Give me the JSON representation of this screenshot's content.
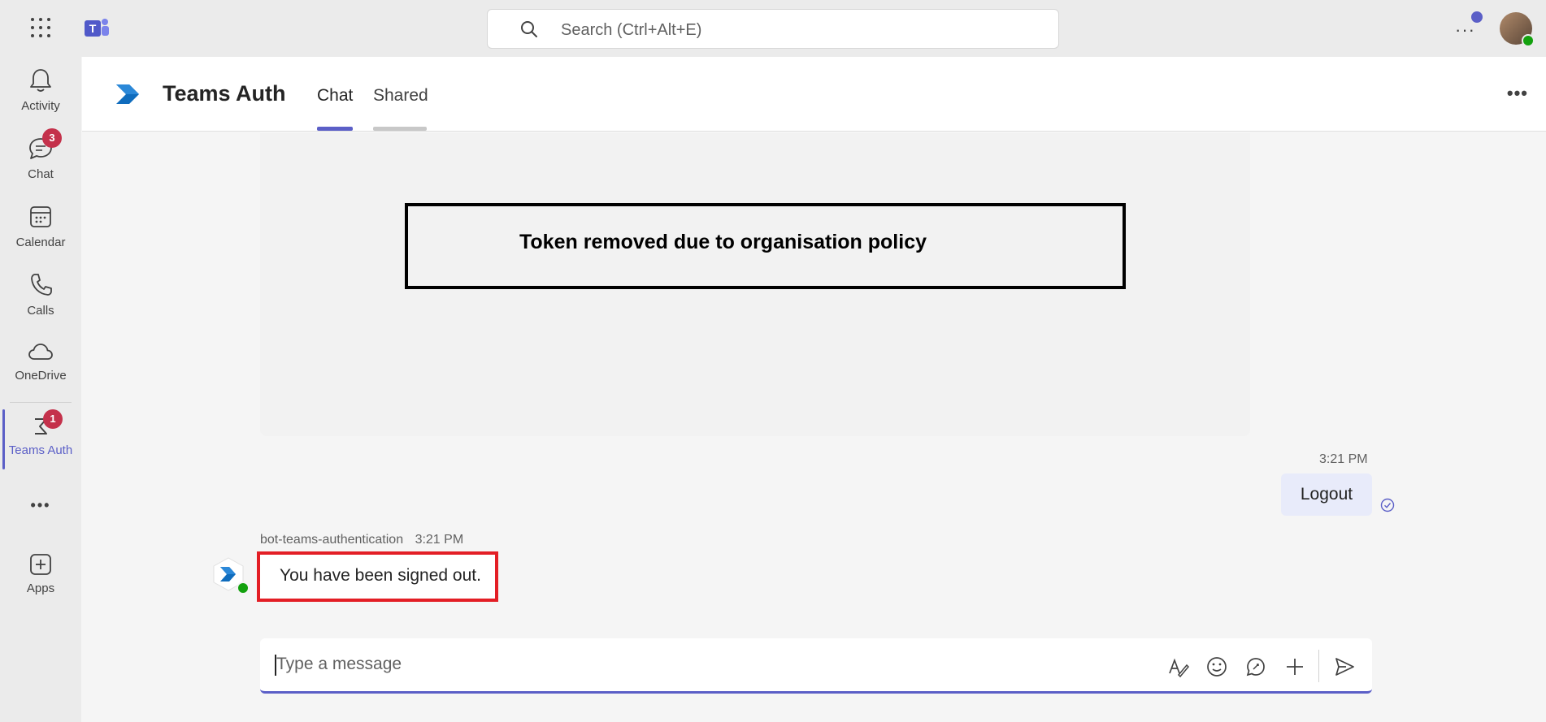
{
  "topbar": {
    "search_placeholder": "Search (Ctrl+Alt+E)",
    "more_label": "···"
  },
  "rail": {
    "items": [
      {
        "label": "Activity",
        "icon": "bell-icon"
      },
      {
        "label": "Chat",
        "icon": "chat-icon",
        "badge": "3"
      },
      {
        "label": "Calendar",
        "icon": "calendar-icon"
      },
      {
        "label": "Calls",
        "icon": "phone-icon"
      },
      {
        "label": "OneDrive",
        "icon": "cloud-icon"
      },
      {
        "label": "Teams Auth",
        "icon": "app-icon",
        "badge": "1",
        "active": true
      },
      {
        "label": "•••",
        "icon": "more-icon"
      },
      {
        "label": "Apps",
        "icon": "add-apps-icon"
      }
    ]
  },
  "header": {
    "title": "Teams Auth",
    "tabs": [
      {
        "label": "Chat",
        "active": true
      },
      {
        "label": "Shared",
        "active": false
      }
    ],
    "more_label": "•••"
  },
  "chat": {
    "token_notice": "Token removed due to organisation policy",
    "outgoing": {
      "time": "3:21 PM",
      "text": "Logout"
    },
    "incoming": {
      "sender": "bot-teams-authentication",
      "time": "3:21 PM",
      "text": "You have been signed out."
    }
  },
  "composer": {
    "placeholder": "Type a message"
  },
  "colors": {
    "accent": "#5b5fc7",
    "badge": "#c4314b",
    "highlight_border": "#e31e25",
    "presence_green": "#13a10e"
  }
}
